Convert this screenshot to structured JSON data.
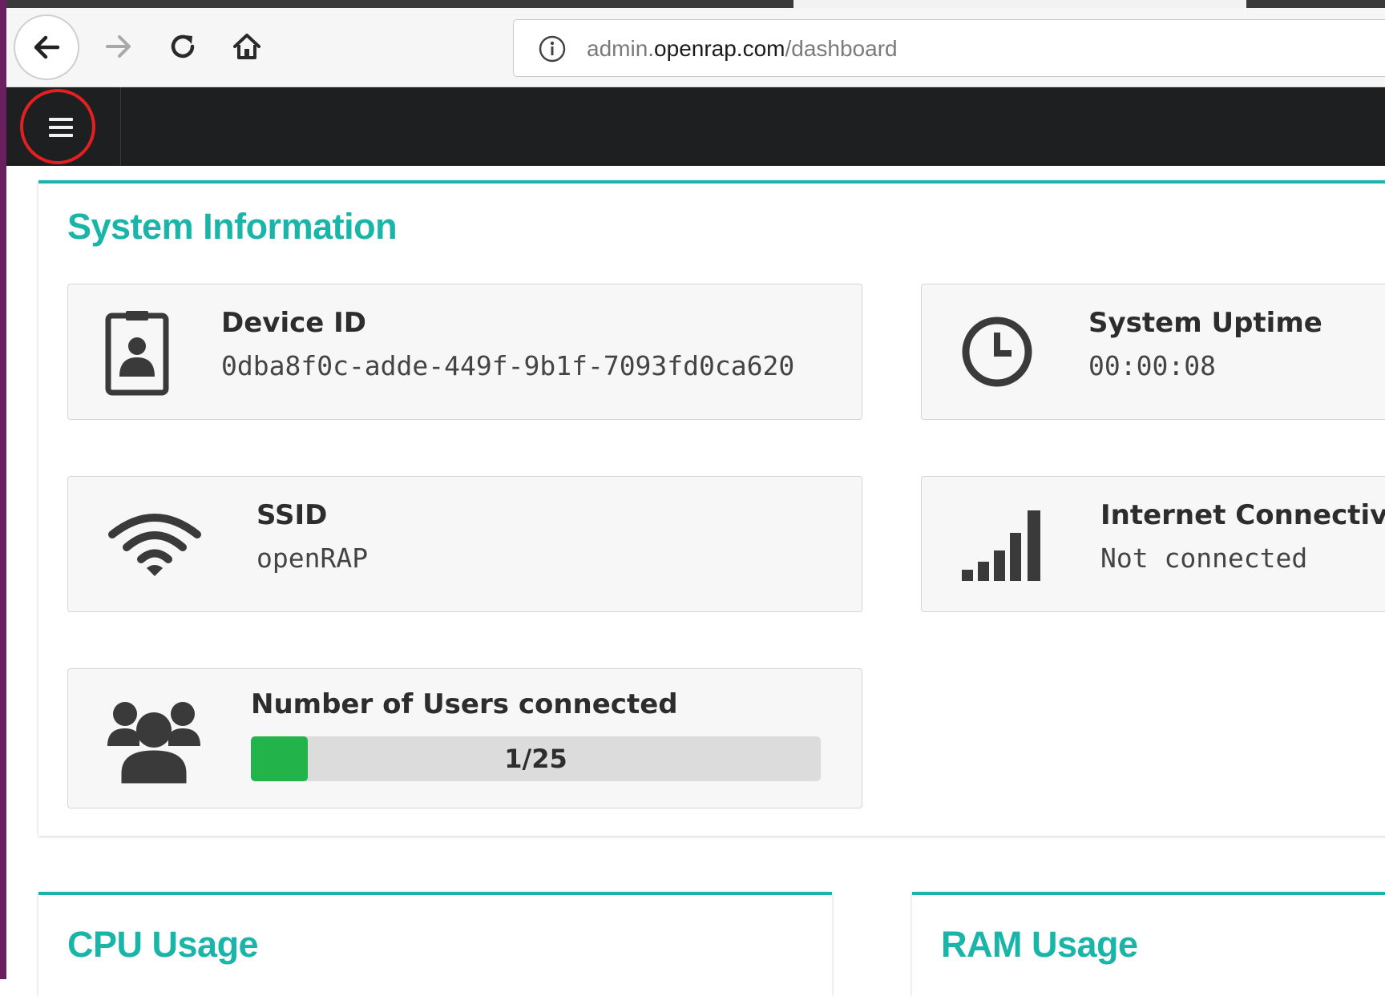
{
  "browser": {
    "url_prefix": "admin.",
    "url_host": "openrap.com",
    "url_path": "/dashboard",
    "icons": {
      "back": "arrow-left-icon",
      "forward": "arrow-right-icon",
      "reload": "reload-icon",
      "home": "home-icon",
      "info": "info-circle-icon"
    }
  },
  "navbar": {
    "menu_icon": "hamburger-menu-icon",
    "highlight_color": "#e3201f"
  },
  "system_info": {
    "title": "System Information",
    "device": {
      "label": "Device ID",
      "value": "0dba8f0c-adde-449f-9b1f-7093fd0ca620",
      "icon": "id-badge-icon"
    },
    "uptime": {
      "label": "System Uptime",
      "value": "00:00:08",
      "icon": "clock-icon"
    },
    "ssid": {
      "label": "SSID",
      "value": "openRAP",
      "icon": "wifi-icon"
    },
    "internet": {
      "label": "Internet Connectivi",
      "value": "Not connected",
      "icon": "signal-bars-icon"
    },
    "users": {
      "label": "Number of Users connected",
      "progress_text": "1/25",
      "connected": 1,
      "max": 25,
      "icon": "users-group-icon"
    }
  },
  "cpu": {
    "title": "CPU Usage"
  },
  "ram": {
    "title": "RAM Usage"
  },
  "colors": {
    "accent": "#1ab5a9",
    "navbar": "#1e1f21",
    "progress_fill": "#22b34a",
    "progress_track": "#dcdcdc",
    "icon": "#3a3a3a"
  }
}
